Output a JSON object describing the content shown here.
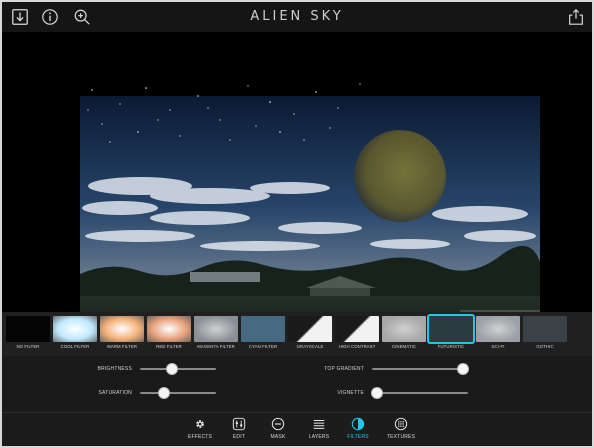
{
  "app": {
    "title": "ALIEN SKY"
  },
  "topbar": {
    "left_icons": [
      "import-icon",
      "info-icon",
      "zoom-in-icon"
    ],
    "right_icons": [
      "share-icon"
    ]
  },
  "filters": [
    {
      "label": "NO FILTER",
      "color": "#050505"
    },
    {
      "label": "COOL FILTER",
      "color": "#bfe9ff"
    },
    {
      "label": "WARM FILTER",
      "color": "#f3b17a"
    },
    {
      "label": "RED FILTER",
      "color": "#e7a27d"
    },
    {
      "label": "MAGENTA FILTER",
      "color": "#8a8f95"
    },
    {
      "label": "CYAN FILTER",
      "color": "#456a82"
    },
    {
      "label": "GRAYSCALE",
      "color": "#808080"
    },
    {
      "label": "HIGH CONTRAST",
      "color": "#9a9a9a"
    },
    {
      "label": "CINEMATIC",
      "color": "#a7a7a7"
    },
    {
      "label": "FUTURISTIC",
      "color": "#2c3b40"
    },
    {
      "label": "SCI-FI",
      "color": "#9aa0a6"
    },
    {
      "label": "GOTHIC",
      "color": "#3a4248"
    }
  ],
  "selected_filter": "FUTURISTIC",
  "accent_color": "#22c6e8",
  "sliders": {
    "brightness": {
      "label": "BRIGHTNESS",
      "value": 0.42
    },
    "saturation": {
      "label": "SATURATION",
      "value": 0.32
    },
    "top_gradient": {
      "label": "TOP GRADIENT",
      "value": 0.95
    },
    "vignette": {
      "label": "VIGNETTE",
      "value": 0.05
    }
  },
  "toolbar": {
    "items": [
      {
        "label": "EFFECTS",
        "icon": "gear-icon"
      },
      {
        "label": "EDIT",
        "icon": "sliders-icon"
      },
      {
        "label": "MASK",
        "icon": "mask-icon"
      },
      {
        "label": "LAYERS",
        "icon": "layers-icon"
      },
      {
        "label": "FILTERS",
        "icon": "filters-icon"
      },
      {
        "label": "TEXTURES",
        "icon": "textures-icon"
      }
    ],
    "active": "FILTERS"
  }
}
